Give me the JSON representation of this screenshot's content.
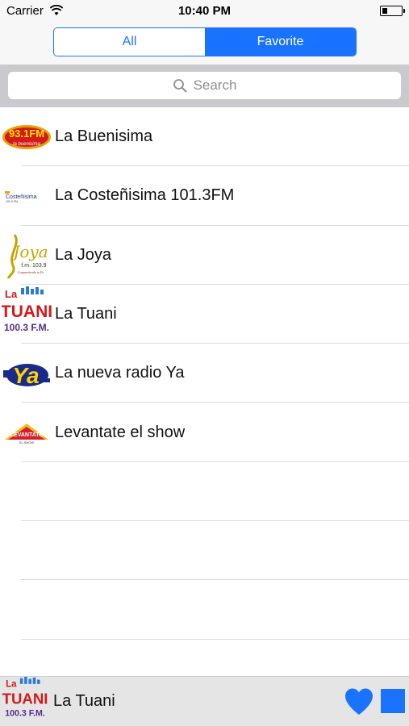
{
  "status_bar": {
    "carrier": "Carrier",
    "time": "10:40 PM"
  },
  "segmented": {
    "all_label": "All",
    "favorite_label": "Favorite",
    "selected": "Favorite"
  },
  "search": {
    "placeholder": "Search"
  },
  "stations": [
    {
      "name": "La Buenisima",
      "logo_text": "93.1FM",
      "logo_icon": "buenisima-logo"
    },
    {
      "name": "La Costeñisima 101.3FM",
      "logo_text": "Costeñisima",
      "logo_icon": "costenisima-logo"
    },
    {
      "name": "La Joya",
      "logo_text": "Joya",
      "logo_sub": "f.m. 103.9",
      "logo_icon": "joya-logo"
    },
    {
      "name": "La Tuani",
      "logo_text": "TUANI",
      "logo_sub": "100.3 F.M.",
      "logo_top": "La",
      "logo_icon": "tuani-logo"
    },
    {
      "name": "La nueva radio Ya",
      "logo_text": "Ya",
      "logo_icon": "radio-ya-logo"
    },
    {
      "name": "Levantate el show",
      "logo_text": "LEVANTATE",
      "logo_sub": "EL SHOW",
      "logo_icon": "levantate-logo"
    }
  ],
  "player": {
    "now_playing": "La Tuani",
    "logo_top": "La",
    "logo_text": "TUANI",
    "logo_sub": "100.3 F.M."
  },
  "colors": {
    "accent": "#1a73ff"
  }
}
